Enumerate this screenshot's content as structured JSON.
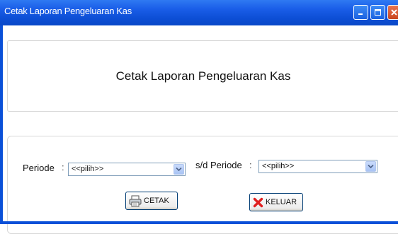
{
  "window": {
    "title": "Cetak Laporan Pengeluaran Kas",
    "controls": [
      "minimize-icon",
      "maximize-icon",
      "close-icon"
    ]
  },
  "header": {
    "title": "Cetak Laporan Pengeluaran Kas"
  },
  "form": {
    "periode_label": "Periode",
    "colon": ":",
    "periode_value": "<<pilih>>",
    "sd_periode_label": "s/d Periode",
    "sd_periode_value": "<<pilih>>"
  },
  "buttons": {
    "cetak_label": "CETAK",
    "keluar_label": "KELUAR"
  },
  "colors": {
    "titlebar": "#0a50d8",
    "close_button": "#c9461f"
  }
}
